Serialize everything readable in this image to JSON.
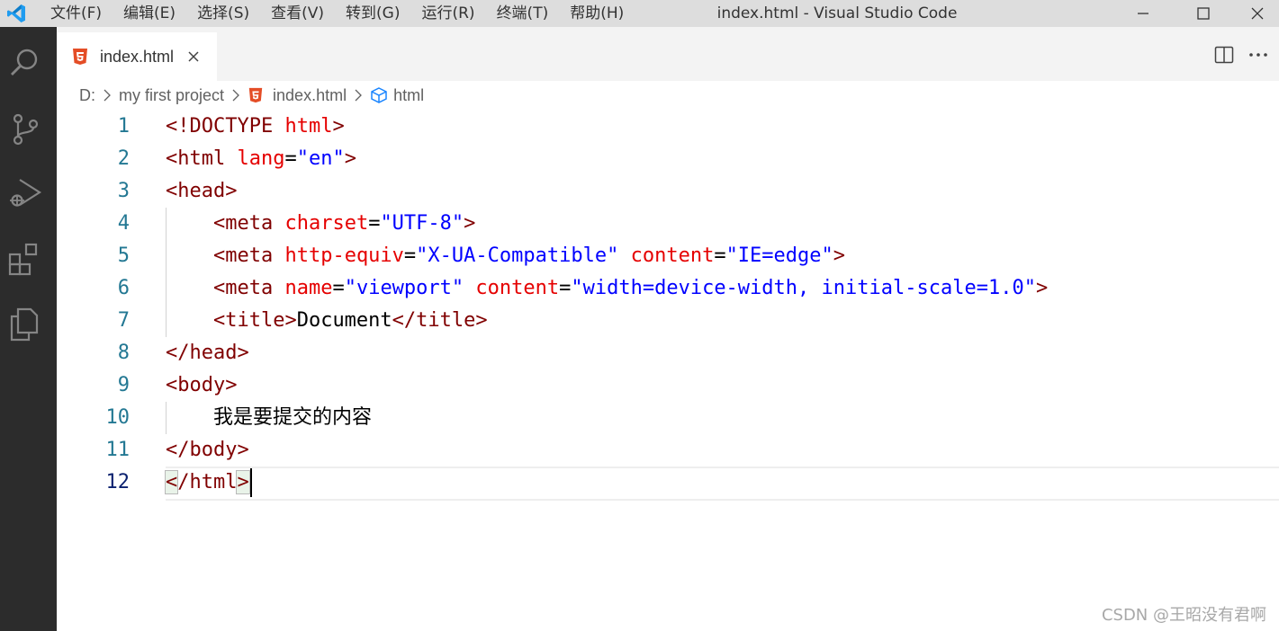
{
  "titlebar": {
    "menu": [
      "文件(F)",
      "编辑(E)",
      "选择(S)",
      "查看(V)",
      "转到(G)",
      "运行(R)",
      "终端(T)",
      "帮助(H)"
    ],
    "title": "index.html - Visual Studio Code"
  },
  "activity_bar": {
    "icons": [
      "search-icon",
      "source-control-icon",
      "run-debug-icon",
      "extensions-icon",
      "explorer-icon"
    ]
  },
  "tab": {
    "label": "index.html",
    "icon": "html5-icon"
  },
  "breadcrumb": {
    "drive": "D:",
    "folder": "my first project",
    "file": "index.html",
    "symbol": "html"
  },
  "code": {
    "current_line": 12,
    "lines": [
      [
        [
          "<!DOCTYPE ",
          "tag"
        ],
        [
          "html",
          "attr"
        ],
        [
          ">",
          "tag"
        ]
      ],
      [
        [
          "<html ",
          "tag"
        ],
        [
          "lang",
          "attr"
        ],
        [
          "=",
          "plain"
        ],
        [
          "\"en\"",
          "str"
        ],
        [
          ">",
          "tag"
        ]
      ],
      [
        [
          "<head>",
          "tag"
        ]
      ],
      [
        [
          "    ",
          "plain"
        ],
        [
          "<meta ",
          "tag"
        ],
        [
          "charset",
          "attr"
        ],
        [
          "=",
          "plain"
        ],
        [
          "\"UTF-8\"",
          "str"
        ],
        [
          ">",
          "tag"
        ]
      ],
      [
        [
          "    ",
          "plain"
        ],
        [
          "<meta ",
          "tag"
        ],
        [
          "http-equiv",
          "attr"
        ],
        [
          "=",
          "plain"
        ],
        [
          "\"X-UA-Compatible\"",
          "str"
        ],
        [
          " ",
          "plain"
        ],
        [
          "content",
          "attr"
        ],
        [
          "=",
          "plain"
        ],
        [
          "\"IE=edge\"",
          "str"
        ],
        [
          ">",
          "tag"
        ]
      ],
      [
        [
          "    ",
          "plain"
        ],
        [
          "<meta ",
          "tag"
        ],
        [
          "name",
          "attr"
        ],
        [
          "=",
          "plain"
        ],
        [
          "\"viewport\"",
          "str"
        ],
        [
          " ",
          "plain"
        ],
        [
          "content",
          "attr"
        ],
        [
          "=",
          "plain"
        ],
        [
          "\"width=device-width, initial-scale=1.0\"",
          "str"
        ],
        [
          ">",
          "tag"
        ]
      ],
      [
        [
          "    ",
          "plain"
        ],
        [
          "<title>",
          "tag"
        ],
        [
          "Document",
          "plain"
        ],
        [
          "</title>",
          "tag"
        ]
      ],
      [
        [
          "</head>",
          "tag"
        ]
      ],
      [
        [
          "<body>",
          "tag"
        ]
      ],
      [
        [
          "    ",
          "plain"
        ],
        [
          "我是要提交的内容",
          "plain"
        ]
      ],
      [
        [
          "</body>",
          "tag"
        ]
      ],
      [
        [
          "<",
          "bracket"
        ],
        [
          "/html",
          "tag"
        ],
        [
          ">",
          "bracket"
        ]
      ]
    ]
  },
  "colors": {
    "tag": "#800000",
    "attr": "#e50000",
    "str": "#0000ff",
    "plain": "#000000",
    "bracket": "#800000",
    "line_number": "#237893",
    "active_line_number": "#0b216f",
    "html_icon": "#e44d26"
  },
  "watermark": "CSDN @王昭没有君啊"
}
